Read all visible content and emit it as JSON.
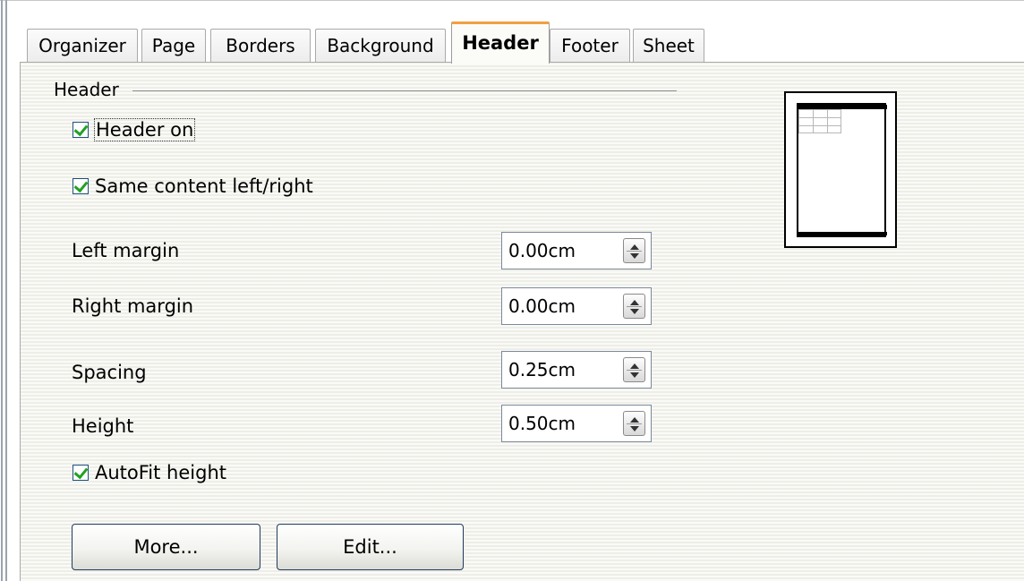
{
  "tabs": [
    {
      "label": "Organizer",
      "active": false
    },
    {
      "label": "Page",
      "active": false
    },
    {
      "label": "Borders",
      "active": false
    },
    {
      "label": "Background",
      "active": false
    },
    {
      "label": "Header",
      "active": true
    },
    {
      "label": "Footer",
      "active": false
    },
    {
      "label": "Sheet",
      "active": false
    }
  ],
  "section": {
    "title": "Header"
  },
  "checkboxes": {
    "header_on": {
      "label": "Header on",
      "checked": true
    },
    "same_content": {
      "label": "Same content left/right",
      "checked": true
    },
    "autofit": {
      "label": "AutoFit height",
      "checked": true
    }
  },
  "fields": {
    "left_margin": {
      "label": "Left margin",
      "value": "0.00cm"
    },
    "right_margin": {
      "label": "Right margin",
      "value": "0.00cm"
    },
    "spacing": {
      "label": "Spacing",
      "value": "0.25cm"
    },
    "height": {
      "label": "Height",
      "value": "0.50cm"
    }
  },
  "buttons": {
    "more": "More...",
    "edit": "Edit..."
  },
  "icons": {
    "spin_up": "arrow-up-icon",
    "spin_down": "arrow-down-icon"
  },
  "colors": {
    "active_tab_accent": "#f0a040",
    "check_mark": "#21a121"
  }
}
